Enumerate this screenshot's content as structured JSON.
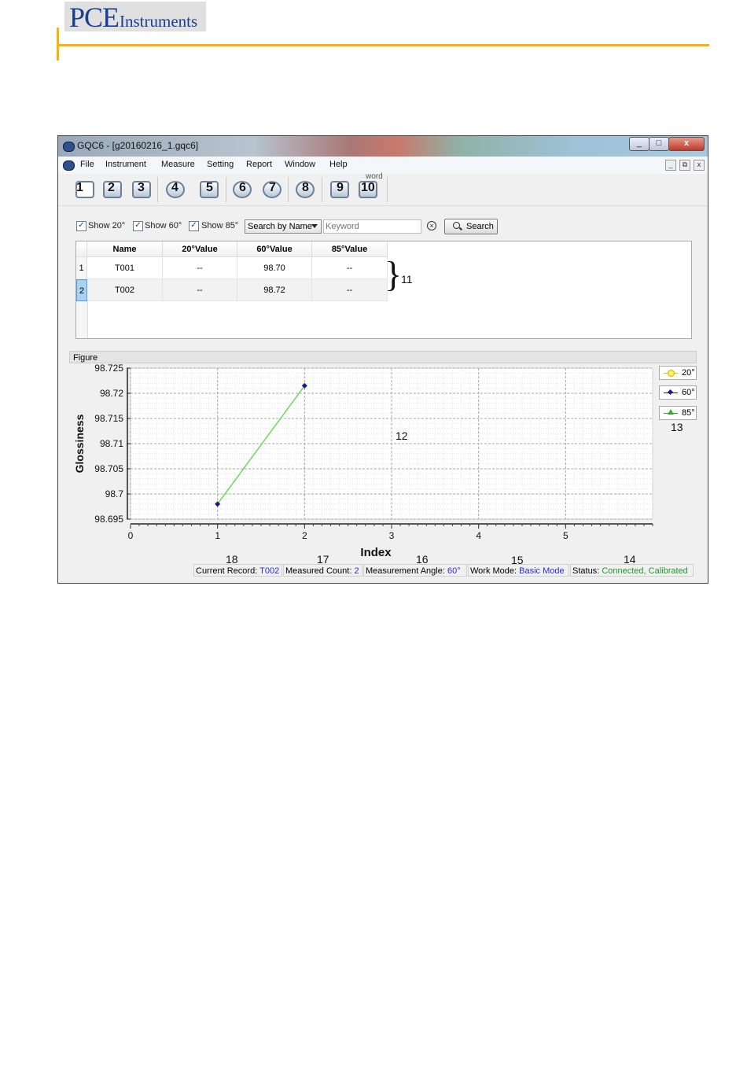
{
  "header": {
    "logo_pce": "PCE",
    "logo_instruments": "Instruments"
  },
  "window": {
    "title": "GQC6 - [g20160216_1.gqc6]",
    "controls": {
      "minimize": "_",
      "maximize": "□",
      "close": "x"
    },
    "mdi_controls": {
      "minimize": "_",
      "restore": "⧉",
      "close": "x"
    }
  },
  "menu": [
    "File",
    "Instrument",
    "Measure",
    "Setting",
    "Report",
    "Window",
    "Help"
  ],
  "toolbar": {
    "buttons": [
      "1",
      "2",
      "3",
      "4",
      "5",
      "6",
      "7",
      "8",
      "9",
      "10"
    ],
    "word_label": "word"
  },
  "filter": {
    "show20": "Show 20°",
    "show60": "Show 60°",
    "show85": "Show 85°",
    "check_mark": "✓",
    "search_by": "Search by Name",
    "keyword_placeholder": "Keyword",
    "clear_glyph": "×",
    "search_label": "Search"
  },
  "table": {
    "headers": [
      "Name",
      "20°Value",
      "60°Value",
      "85°Value"
    ],
    "rows": [
      {
        "index": "1",
        "name": "T001",
        "v20": "--",
        "v60": "98.70",
        "v85": "--"
      },
      {
        "index": "2",
        "name": "T002",
        "v20": "--",
        "v60": "98.72",
        "v85": "--"
      }
    ]
  },
  "figure": {
    "label": "Figure"
  },
  "chart_data": {
    "type": "line",
    "xlabel": "Index",
    "ylabel": "Glossiness",
    "xlim": [
      0,
      6
    ],
    "ylim": [
      98.695,
      98.725
    ],
    "xticks": [
      "0",
      "1",
      "2",
      "3",
      "4",
      "5"
    ],
    "yticks": [
      "98.695",
      "98.7",
      "98.705",
      "98.71",
      "98.715",
      "98.72",
      "98.725"
    ],
    "grid": true,
    "legend_position": "right",
    "series": [
      {
        "name": "20°",
        "color": "#e8d000",
        "marker": "circle",
        "x": [],
        "y": []
      },
      {
        "name": "60°",
        "color": "#1a1a8c",
        "line_color": "#66dd55",
        "marker": "diamond",
        "x": [
          1,
          2
        ],
        "y": [
          98.698,
          98.7215
        ]
      },
      {
        "name": "85°",
        "color": "#33aa33",
        "marker": "triangle",
        "x": [],
        "y": []
      }
    ]
  },
  "status": {
    "current_record_label": "Current Record:",
    "current_record_value": "T002",
    "measured_count_label": "Measured Count:",
    "measured_count_value": "2",
    "angle_label": "Measurement Angle:",
    "angle_value": "60°",
    "work_mode_label": "Work Mode:",
    "work_mode_value": "Basic Mode",
    "status_label": "Status:",
    "status_value": "Connected, Calibrated"
  },
  "annotations": {
    "n11": "11",
    "n12": "12",
    "n13": "13",
    "n14": "14",
    "n15": "15",
    "n16": "16",
    "n17": "17",
    "n18": "18",
    "brace": "}"
  }
}
